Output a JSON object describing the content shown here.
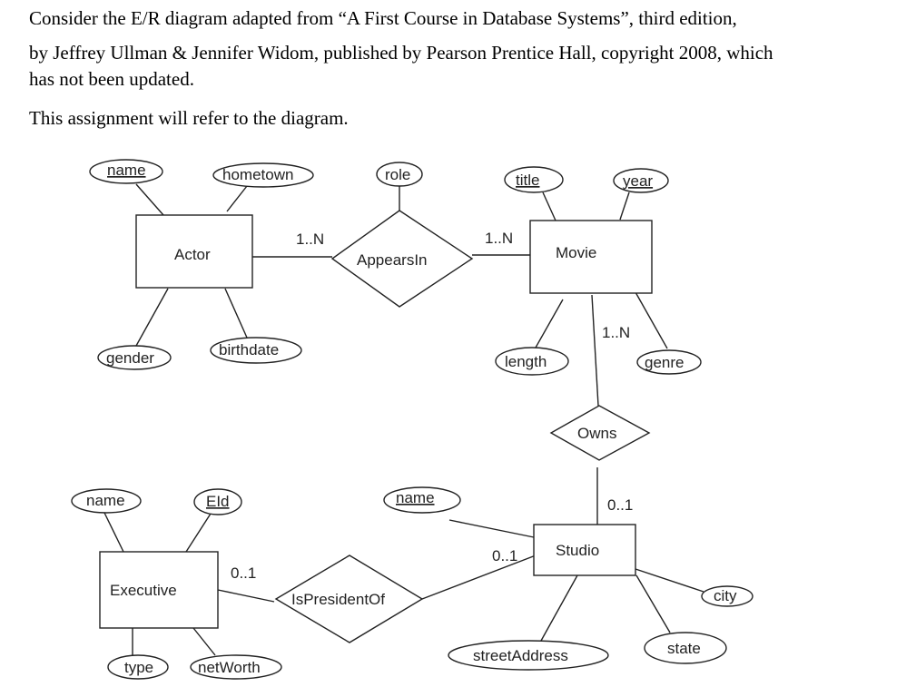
{
  "document": {
    "intro_line1": "Consider the E/R diagram adapted from “A First Course in Database Systems”, third edition,",
    "intro_line2": "by Jeffrey Ullman & Jennifer Widom, published by Pearson Prentice Hall, copyright 2008, which",
    "intro_line3": "has not been updated.",
    "note": "This assignment will refer to the diagram."
  },
  "diagram": {
    "entities": {
      "actor": "Actor",
      "movie": "Movie",
      "studio": "Studio",
      "executive": "Executive"
    },
    "relationships": {
      "appears_in": "AppearsIn",
      "owns": "Owns",
      "is_president_of": "IsPresidentOf"
    },
    "attributes": {
      "actor": {
        "name": "name",
        "hometown": "hometown",
        "gender": "gender",
        "birthdate": "birthdate"
      },
      "appears_in": {
        "role": "role"
      },
      "movie": {
        "title": "title",
        "year": "year",
        "length": "length",
        "genre": "genre"
      },
      "studio": {
        "name": "name",
        "street_address": "streetAddress",
        "state": "state",
        "city": "city"
      },
      "executive": {
        "name": "name",
        "eid": "EId",
        "type": "type",
        "net_worth": "netWorth"
      }
    },
    "key_attributes": [
      "actor.name",
      "movie.title",
      "movie.year",
      "studio.name",
      "executive.EId"
    ],
    "cardinalities": {
      "actor_appears_in": "1..N",
      "movie_appears_in": "1..N",
      "movie_owns": "1..N",
      "studio_owns": "0..1",
      "executive_is_president_of": "0..1",
      "studio_is_president_of": "0..1"
    }
  }
}
